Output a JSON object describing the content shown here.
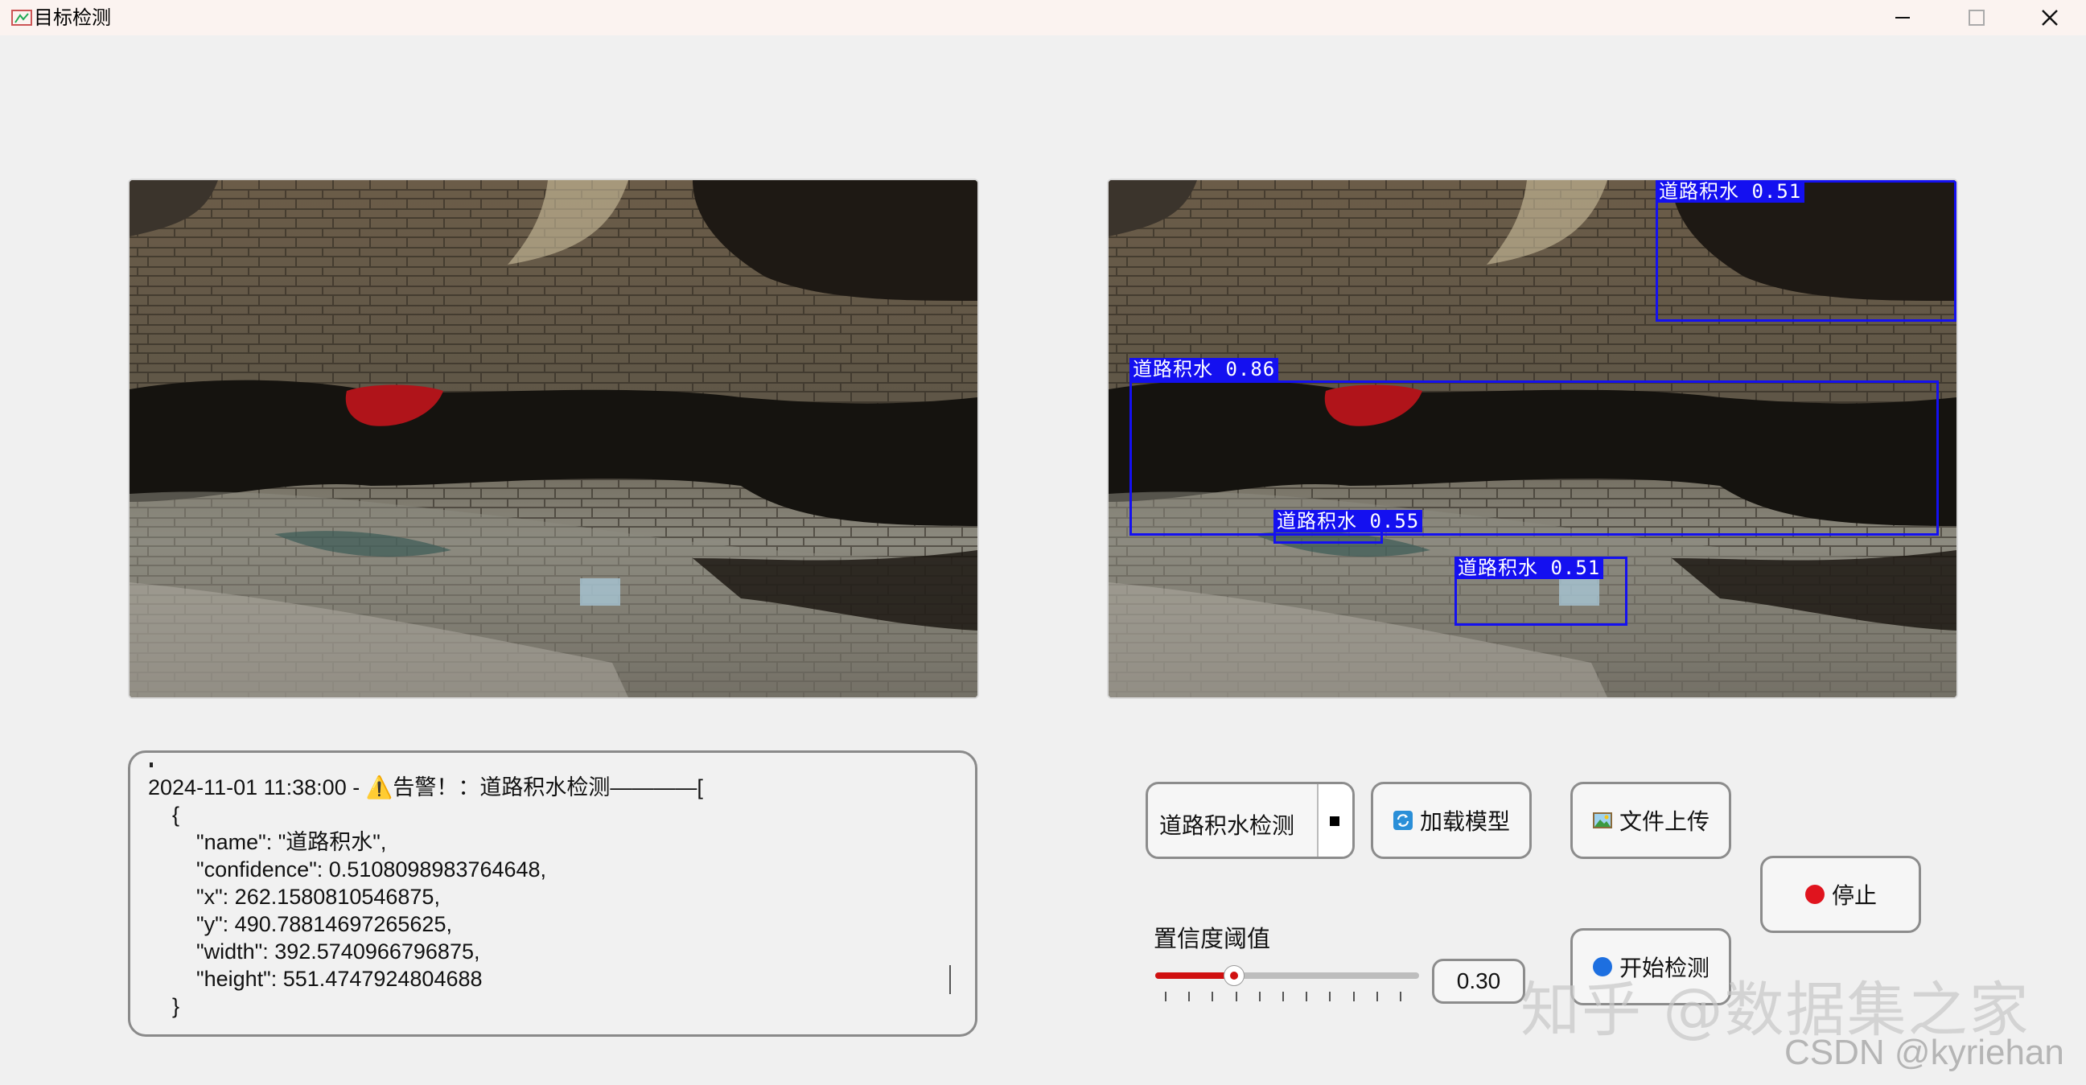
{
  "window": {
    "title": "目标检测"
  },
  "detections": [
    {
      "label": "道路积水 0.51"
    },
    {
      "label": "道路积水 0.86"
    },
    {
      "label": "道路积水 0.55"
    },
    {
      "label": "道路积水 0.51"
    }
  ],
  "log": {
    "lines": [
      "2024-11-01 11:38:00 - ⚠️告警！：道路积水检测————[",
      "    {",
      "        \"name\": \"道路积水\",",
      "        \"confidence\": 0.5108098983764648,",
      "        \"x\": 262.1580810546875,",
      "        \"y\": 490.78814697265625,",
      "        \"width\": 392.5740966796875,",
      "        \"height\": 551.4747924804688",
      "    }"
    ]
  },
  "controls": {
    "model_select_value": "道路积水检测",
    "load_model_label": "加载模型",
    "upload_label": "文件上传",
    "stop_label": "停止",
    "start_label": "开始检测",
    "threshold_label": "置信度阈值",
    "threshold_value": "0.30",
    "threshold_fraction": 0.3
  },
  "watermark": {
    "zhihu": "知乎 @数据集之家",
    "csdn": "CSDN @kyriehan"
  },
  "colors": {
    "box": "#1410f0",
    "slider_accent": "#d01010",
    "stop_dot": "#e0141e"
  }
}
